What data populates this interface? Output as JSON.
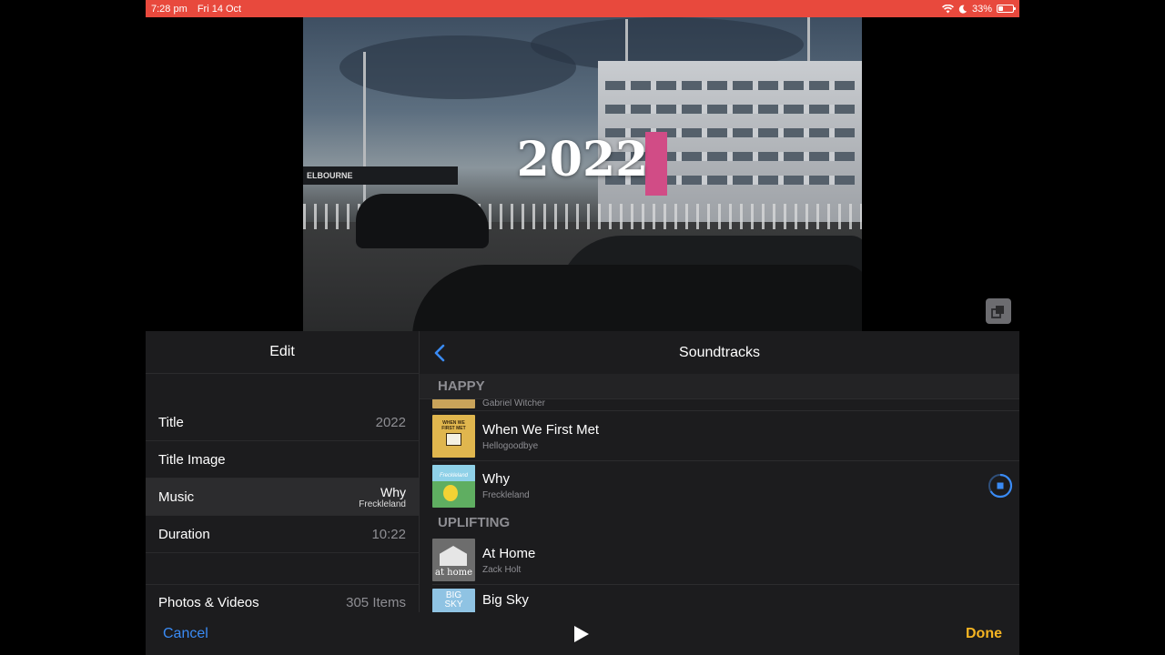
{
  "status_bar": {
    "time": "7:28 pm",
    "date": "Fri 14 Oct",
    "battery": "33%",
    "battery_level": 0.33
  },
  "preview": {
    "title": "2022",
    "sign_text": "ELBOURNE"
  },
  "edit_panel": {
    "header": "Edit",
    "rows": [
      {
        "label": "Title",
        "value": "2022"
      },
      {
        "label": "Title Image",
        "value": ""
      },
      {
        "label": "Music",
        "value": "Why",
        "subvalue": "Freckleland"
      },
      {
        "label": "Duration",
        "value": "10:22"
      },
      {
        "label": "Photos & Videos",
        "value": "305 Items"
      }
    ]
  },
  "soundtracks": {
    "header": "Soundtracks",
    "sections": [
      {
        "name": "HAPPY",
        "tracks": [
          {
            "title": "",
            "artist": "Gabriel Witcher",
            "art_color": "#c9a35a"
          },
          {
            "title": "When We First Met",
            "artist": "Hellogoodbye",
            "art_color": "#e0b64e",
            "art_text": "WHEN WE FIRST MET"
          },
          {
            "title": "Why",
            "artist": "Freckleland",
            "art_color": "#5fae61",
            "art_text": "Freckleland",
            "playing": true
          }
        ]
      },
      {
        "name": "UPLIFTING",
        "tracks": [
          {
            "title": "At Home",
            "artist": "Zack Holt",
            "art_color": "#6d6d6d",
            "art_text": "at home"
          },
          {
            "title": "Big Sky",
            "artist": "",
            "art_color": "#8fc3e3",
            "art_text": "BIG SKY"
          }
        ]
      }
    ]
  },
  "toolbar": {
    "cancel": "Cancel",
    "done": "Done"
  },
  "colors": {
    "status_bar": "#e8493d",
    "accent_blue": "#3a8bf5",
    "accent_yellow": "#f5b422"
  }
}
